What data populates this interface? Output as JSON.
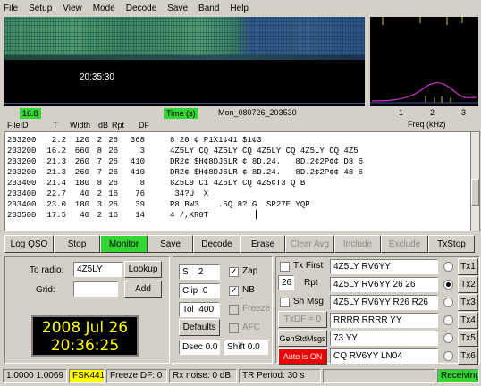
{
  "menu": [
    "File",
    "Setup",
    "View",
    "Mode",
    "Decode",
    "Save",
    "Band",
    "Help"
  ],
  "waterfall": {
    "time": "20:35:30"
  },
  "readouts": {
    "left_value": "16.8",
    "time_label": "Time (s)",
    "file_stamp": "Mon_080726_203530",
    "freq_ticks": [
      "1",
      "2",
      "3"
    ],
    "freq_label": "Freq (kHz)"
  },
  "columns": [
    "FileID",
    "T",
    "Width",
    "dB",
    "Rpt",
    "DF"
  ],
  "decodes": [
    {
      "id": "203200",
      "t": "2.2",
      "width": "120",
      "db": "2",
      "rpt": "26",
      "df": "368",
      "msg": "8 20 ¢ P1X1¢41 $1¢3"
    },
    {
      "id": "203200",
      "t": "16.2",
      "width": "660",
      "db": "8",
      "rpt": "26",
      "df": "3",
      "msg": "4Z5LY CQ 4Z5LY CQ 4Z5LY CQ 4Z5LY CQ 4Z5"
    },
    {
      "id": "203200",
      "t": "21.3",
      "width": "260",
      "db": "7",
      "rpt": "26",
      "df": "410",
      "msg": "DR2¢ $H¢8DJ6LR ¢ 8D.24.   8D.2¢2P¢¢ D8 6"
    },
    {
      "id": "203200",
      "t": "21.3",
      "width": "260",
      "db": "7",
      "rpt": "26",
      "df": "410",
      "msg": "DR2¢ $H¢8DJ6LR ¢ 8D.24.   8D.2¢2P¢¢ 48 6"
    },
    {
      "id": "203400",
      "t": "21.4",
      "width": "180",
      "db": "8",
      "rpt": "26",
      "df": "8",
      "msg": "8Z5L9 C1 4Z5LY CQ 4Z5¢T3 Q B"
    },
    {
      "id": "203400",
      "t": "22.7",
      "width": "40",
      "db": "2",
      "rpt": "16",
      "df": "76",
      "msg": " 34?U  X"
    },
    {
      "id": "203400",
      "t": "23.0",
      "width": "180",
      "db": "3",
      "rpt": "26",
      "df": "39",
      "msg": "P8 BW3    .5Q 8? G  SP27E YQP"
    },
    {
      "id": "203500",
      "t": "17.5",
      "width": "40",
      "db": "2",
      "rpt": "16",
      "df": "14",
      "msg": "4 /,KR8T"
    }
  ],
  "buttons": {
    "log_qso": "Log QSO",
    "stop": "Stop",
    "monitor": "Monitor",
    "save": "Save",
    "decode": "Decode",
    "erase": "Erase",
    "clear_avg": "Clear Avg",
    "include": "Include",
    "exclude": "Exclude",
    "tx_stop": "TxStop"
  },
  "station": {
    "to_radio_label": "To radio:",
    "to_radio_value": "4Z5LY",
    "lookup": "Lookup",
    "grid_label": "Grid:",
    "grid_value": "",
    "add": "Add",
    "date": "2008 Jul 26",
    "time": "20:36:25"
  },
  "controls": {
    "s_label": "S",
    "s_value": "2",
    "clip_label": "Clip",
    "clip_value": "0",
    "tol_label": "Tol",
    "tol_value": "400",
    "defaults": "Defaults",
    "dsec_label": "Dsec",
    "dsec_value": "0.0",
    "shift_label": "Shift",
    "shift_value": "0.0",
    "zap": "Zap",
    "nb": "NB",
    "freeze": "Freeze",
    "afc": "AFC"
  },
  "tx_options": {
    "tx_first": "Tx First",
    "rpt_value": "26",
    "rpt_label": "Rpt",
    "sh_msg": "Sh Msg",
    "txdf": "TxDF = 0",
    "gen_std": "GenStdMsgs",
    "auto": "Auto is ON"
  },
  "tx_messages": [
    {
      "text": "4Z5LY RV6YY",
      "btn": "Tx1",
      "selected": false
    },
    {
      "text": "4Z5LY RV6YY 26 26",
      "btn": "Tx2",
      "selected": true
    },
    {
      "text": "4Z5LY RV6YY R26 R26",
      "btn": "Tx3",
      "selected": false
    },
    {
      "text": "RRRR RRRR YY",
      "btn": "Tx4",
      "selected": false
    },
    {
      "text": "73 YY",
      "btn": "Tx5",
      "selected": false
    },
    {
      "text": "CQ RV6YY LN04",
      "btn": "Tx6",
      "selected": false
    }
  ],
  "status": {
    "ratio": "1.0000 1.0069",
    "mode": "FSK441",
    "freeze_df": "Freeze DF:  0",
    "rx_noise": "Rx noise:  0 dB",
    "tr_period": "TR Period:  30 s",
    "receiving": "Receiving"
  },
  "colors": {
    "green": "#33d633",
    "yellow": "#ffff00",
    "red": "#ee0000",
    "spectrum_line": "#cc33cc",
    "marker": "#d8c23a"
  }
}
